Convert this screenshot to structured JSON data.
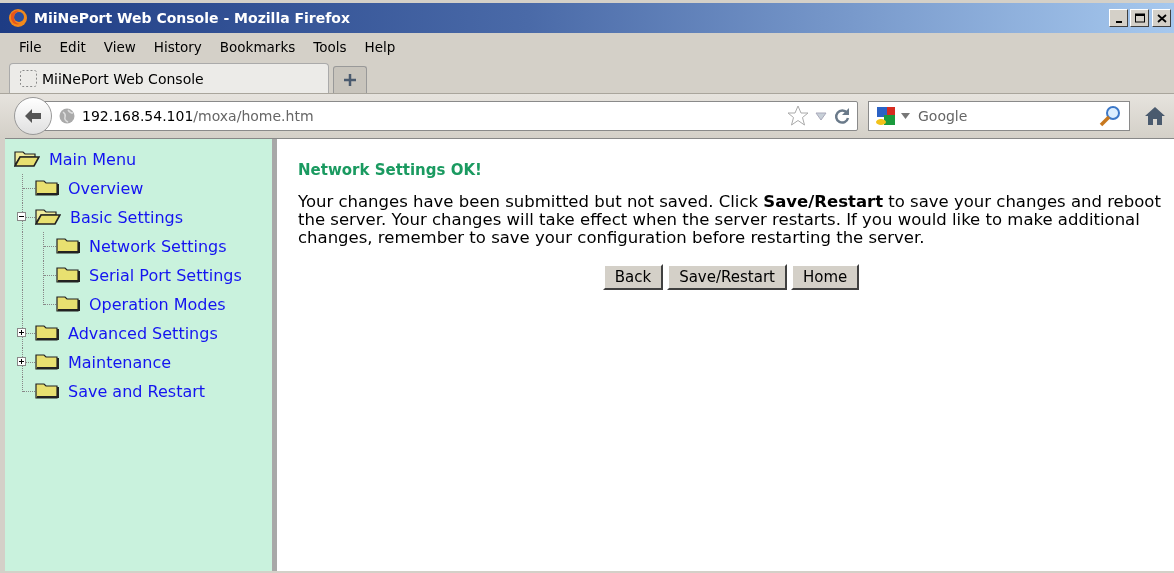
{
  "window": {
    "title": "MiiNePort Web Console - Mozilla Firefox"
  },
  "menu": [
    {
      "label": "File"
    },
    {
      "label": "Edit"
    },
    {
      "label": "View"
    },
    {
      "label": "History"
    },
    {
      "label": "Bookmarks"
    },
    {
      "label": "Tools"
    },
    {
      "label": "Help"
    }
  ],
  "tabs": [
    {
      "label": "MiiNePort Web Console",
      "selected": true
    }
  ],
  "address": {
    "host": "192.168.54.101",
    "path": "/moxa/home.htm"
  },
  "search": {
    "placeholder": "Google"
  },
  "sidebar": {
    "root": {
      "label": "Main Menu",
      "children": [
        {
          "label": "Overview",
          "kind": "leaf"
        },
        {
          "label": "Basic Settings",
          "kind": "group",
          "expanded": true,
          "children": [
            {
              "label": "Network Settings",
              "kind": "leaf"
            },
            {
              "label": "Serial Port Settings",
              "kind": "leaf"
            },
            {
              "label": "Operation Modes",
              "kind": "leaf"
            }
          ]
        },
        {
          "label": "Advanced Settings",
          "kind": "group",
          "expanded": false
        },
        {
          "label": "Maintenance",
          "kind": "group",
          "expanded": false
        },
        {
          "label": "Save and Restart",
          "kind": "leaf"
        }
      ]
    }
  },
  "content": {
    "heading": "Network Settings OK!",
    "message": "Your changes have been submitted but not saved. Click **Save/Restart** to save your changes and reboot the server. Your changes will take effect when the server restarts. If you would like to make additional changes, remember to save your configuration before restarting the server.",
    "buttons": [
      {
        "label": "Back"
      },
      {
        "label": "Save/Restart"
      },
      {
        "label": "Home"
      }
    ]
  }
}
